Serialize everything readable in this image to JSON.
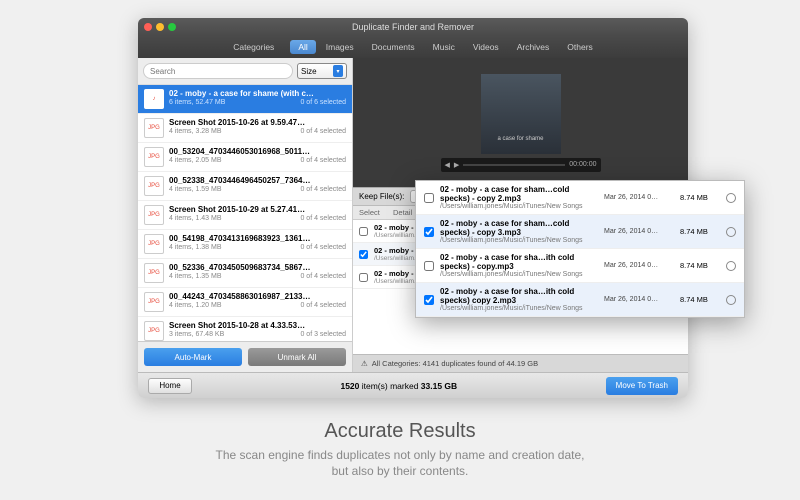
{
  "window": {
    "title": "Duplicate Finder and Remover",
    "tabs": [
      "Categories",
      "All",
      "Images",
      "Documents",
      "Music",
      "Videos",
      "Archives",
      "Others"
    ],
    "active_tab": 1
  },
  "sidebar": {
    "search_placeholder": "Search",
    "sort_label": "Size",
    "automark_label": "Auto-Mark",
    "unmark_label": "Unmark All",
    "items": [
      {
        "name": "02 - moby - a case for shame (with c…",
        "meta_left": "6 items, 52.47 MB",
        "meta_right": "0 of 6 selected",
        "selected": true,
        "icon": "♪"
      },
      {
        "name": "Screen Shot 2015-10-26 at 9.59.47…",
        "meta_left": "4 items, 3.28 MB",
        "meta_right": "0 of 4 selected",
        "icon": "JPG"
      },
      {
        "name": "00_53204_4703446053016968_5011…",
        "meta_left": "4 items, 2.05 MB",
        "meta_right": "0 of 4 selected",
        "icon": "JPG"
      },
      {
        "name": "00_52338_4703446496450257_7364…",
        "meta_left": "4 items, 1.59 MB",
        "meta_right": "0 of 4 selected",
        "icon": "JPG"
      },
      {
        "name": "Screen Shot 2015-10-29 at 5.27.41…",
        "meta_left": "4 items, 1.43 MB",
        "meta_right": "0 of 4 selected",
        "icon": "JPG"
      },
      {
        "name": "00_54198_4703413169683923_1361…",
        "meta_left": "4 items, 1.38 MB",
        "meta_right": "0 of 4 selected",
        "icon": "JPG"
      },
      {
        "name": "00_52336_4703450509683734_5867…",
        "meta_left": "4 items, 1.35 MB",
        "meta_right": "0 of 4 selected",
        "icon": "JPG"
      },
      {
        "name": "00_44243_4703458863016987_2133…",
        "meta_left": "4 items, 1.20 MB",
        "meta_right": "0 of 4 selected",
        "icon": "JPG"
      },
      {
        "name": "Screen Shot 2015-10-28 at 4.33.53…",
        "meta_left": "3 items, 67.48 KB",
        "meta_right": "0 of 3 selected",
        "icon": "JPG"
      }
    ]
  },
  "preview": {
    "album_line1": "a case for shame",
    "timecode": "00:00:00"
  },
  "keepbar": {
    "label": "Keep File(s):",
    "seg_all": "All",
    "seg_old": "Old…"
  },
  "listhdr": {
    "c1": "Select",
    "c2": "Detail"
  },
  "duplist": [
    {
      "title": "02 - moby - a …",
      "path": "/Users/william.jon…",
      "checked": false
    },
    {
      "title": "02 - moby - a case for sha…ith cold specks) - copy.mp3",
      "path": "/Users/william.jones/Music/iTunes/New Songs",
      "date": "Mar 26, 2014 0…",
      "size": "8.74 MB",
      "checked": true,
      "alt": true
    },
    {
      "title": "02 - moby - a case for sha…ith cold specks) copy 2.mp3",
      "path": "/Users/william.jones/Music/iTunes/New Songs",
      "date": "Mar 26, 2014 0…",
      "size": "8.74 MB",
      "checked": false
    }
  ],
  "status": "All Categories: 4141 duplicates found of  44.19 GB",
  "bottom": {
    "home": "Home",
    "summary_count": "1520",
    "summary_mid": " item(s) marked ",
    "summary_size": "33.15 GB",
    "move": "Move To Trash"
  },
  "popout": [
    {
      "title": "02 - moby - a case for sham…cold specks) - copy 2.mp3",
      "path": "/Users/william.jones/Music/iTunes/New Songs",
      "date": "Mar 26, 2014 0…",
      "size": "8.74 MB",
      "checked": false
    },
    {
      "title": "02 - moby - a case for sham…cold specks) - copy 3.mp3",
      "path": "/Users/william.jones/Music/iTunes/New Songs",
      "date": "Mar 26, 2014 0…",
      "size": "8.74 MB",
      "checked": true,
      "alt": true
    },
    {
      "title": "02 - moby - a case for sha…ith cold specks) - copy.mp3",
      "path": "/Users/william.jones/Music/iTunes/New Songs",
      "date": "Mar 26, 2014 0…",
      "size": "8.74 MB",
      "checked": false
    },
    {
      "title": "02 - moby - a case for sha…ith cold specks) copy 2.mp3",
      "path": "/Users/william.jones/Music/iTunes/New Songs",
      "date": "Mar 26, 2014 0…",
      "size": "8.74 MB",
      "checked": true,
      "alt": true
    }
  ],
  "caption": {
    "heading": "Accurate Results",
    "line1": "The scan engine finds duplicates not only by name and creation date,",
    "line2": "but also by their contents."
  }
}
